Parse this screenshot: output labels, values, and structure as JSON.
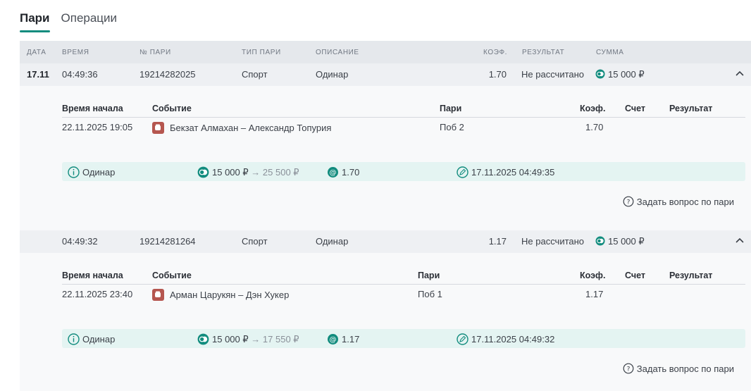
{
  "tabs": [
    {
      "label": "Пари",
      "active": true
    },
    {
      "label": "Операции",
      "active": false
    }
  ],
  "table_headers": {
    "date": "ДАТА",
    "time": "ВРЕМЯ",
    "number": "№ ПАРИ",
    "type": "ТИП ПАРИ",
    "description": "ОПИСАНИЕ",
    "coef": "КОЭФ.",
    "result": "РЕЗУЛЬТАТ",
    "amount": "СУММА"
  },
  "detail_headers": {
    "start_time": "Время начала",
    "event": "Событие",
    "bets": "Пари",
    "coef": "Коэф.",
    "score": "Счет",
    "result": "Результат"
  },
  "bets": [
    {
      "date": "17.11",
      "time": "04:49:36",
      "number": "19214282025",
      "type": "Спорт",
      "description": "Одинар",
      "coef": "1.70",
      "result": "Не рассчитано",
      "amount": "15 000 ₽",
      "detail": {
        "start_time": "22.11.2025 19:05",
        "event": "Бекзат Алмахан – Александр Топурия",
        "pick": "Поб 2",
        "coef": "1.70",
        "score": "",
        "result": ""
      },
      "summary": {
        "kind": "Одинар",
        "stake": "15 000 ₽",
        "arrow": "→",
        "payout": "25 500 ₽",
        "coef": "1.70",
        "placed": "17.11.2025 04:49:35"
      },
      "ask_label": "Задать вопрос по пари"
    },
    {
      "date": "",
      "time": "04:49:32",
      "number": "19214281264",
      "type": "Спорт",
      "description": "Одинар",
      "coef": "1.17",
      "result": "Не рассчитано",
      "amount": "15 000 ₽",
      "detail": {
        "start_time": "22.11.2025 23:40",
        "event": "Арман Царукян – Дэн Хукер",
        "pick": "Поб 1",
        "coef": "1.17",
        "score": "",
        "result": ""
      },
      "summary": {
        "kind": "Одинар",
        "stake": "15 000 ₽",
        "arrow": "→",
        "payout": "17 550 ₽",
        "coef": "1.17",
        "placed": "17.11.2025 04:49:32"
      },
      "ask_label": "Задать вопрос по пари"
    }
  ],
  "colors": {
    "accent": "#128c7e",
    "row_bg": "#eef0f3",
    "header_bg": "#e5e8ec",
    "info_bg": "#e4f4f2",
    "sport_icon": "#b5564f"
  }
}
